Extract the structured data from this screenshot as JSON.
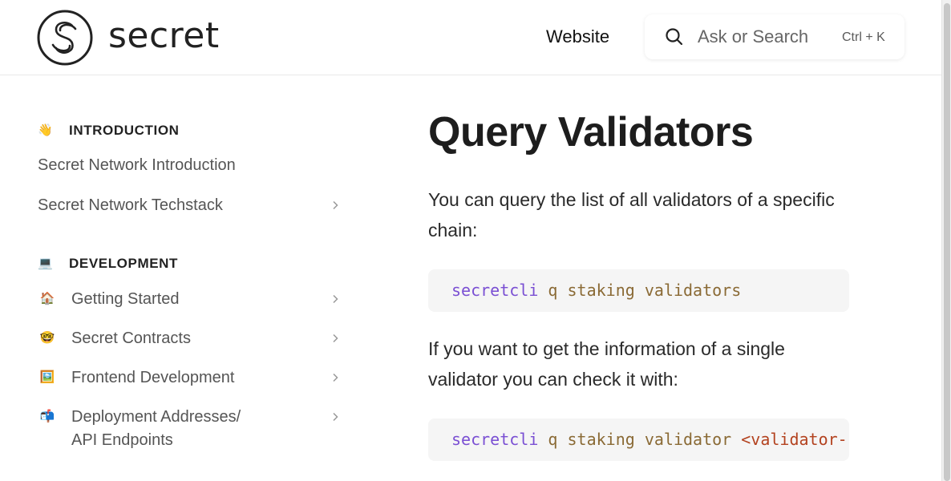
{
  "header": {
    "logo_text": "secret",
    "nav_website": "Website",
    "search": {
      "placeholder": "Ask or Search",
      "shortcut": "Ctrl + K"
    }
  },
  "sidebar": {
    "introduction": {
      "title": "INTRODUCTION",
      "emoji": "👋",
      "items": [
        {
          "label": "Secret Network Introduction"
        },
        {
          "label": "Secret Network Techstack",
          "expandable": true
        }
      ]
    },
    "development": {
      "title": "DEVELOPMENT",
      "emoji": "💻",
      "items": [
        {
          "label": "Getting Started",
          "emoji": "🏠",
          "expandable": true
        },
        {
          "label": "Secret Contracts",
          "emoji": "🤓",
          "expandable": true
        },
        {
          "label": "Frontend Development",
          "emoji": "🖼️",
          "expandable": true
        },
        {
          "label_line1": "Deployment Addresses/",
          "label_line2": "API Endpoints",
          "emoji": "📬",
          "expandable": true
        }
      ]
    }
  },
  "main": {
    "title": "Query Validators",
    "para1": "You can query the list of all validators of a specific chain:",
    "code1": {
      "cmd": "secretcli",
      "args": "q staking validators"
    },
    "para2": "If you want to get the information of a single validator you can check it with:",
    "code2": {
      "cmd": "secretcli",
      "args": "q staking validator",
      "placeholder": "<validator-"
    }
  },
  "colors": {
    "command": "#7a4fd3",
    "argument": "#8a6a35",
    "placeholder": "#b3421f",
    "code_background": "#f5f5f5"
  }
}
